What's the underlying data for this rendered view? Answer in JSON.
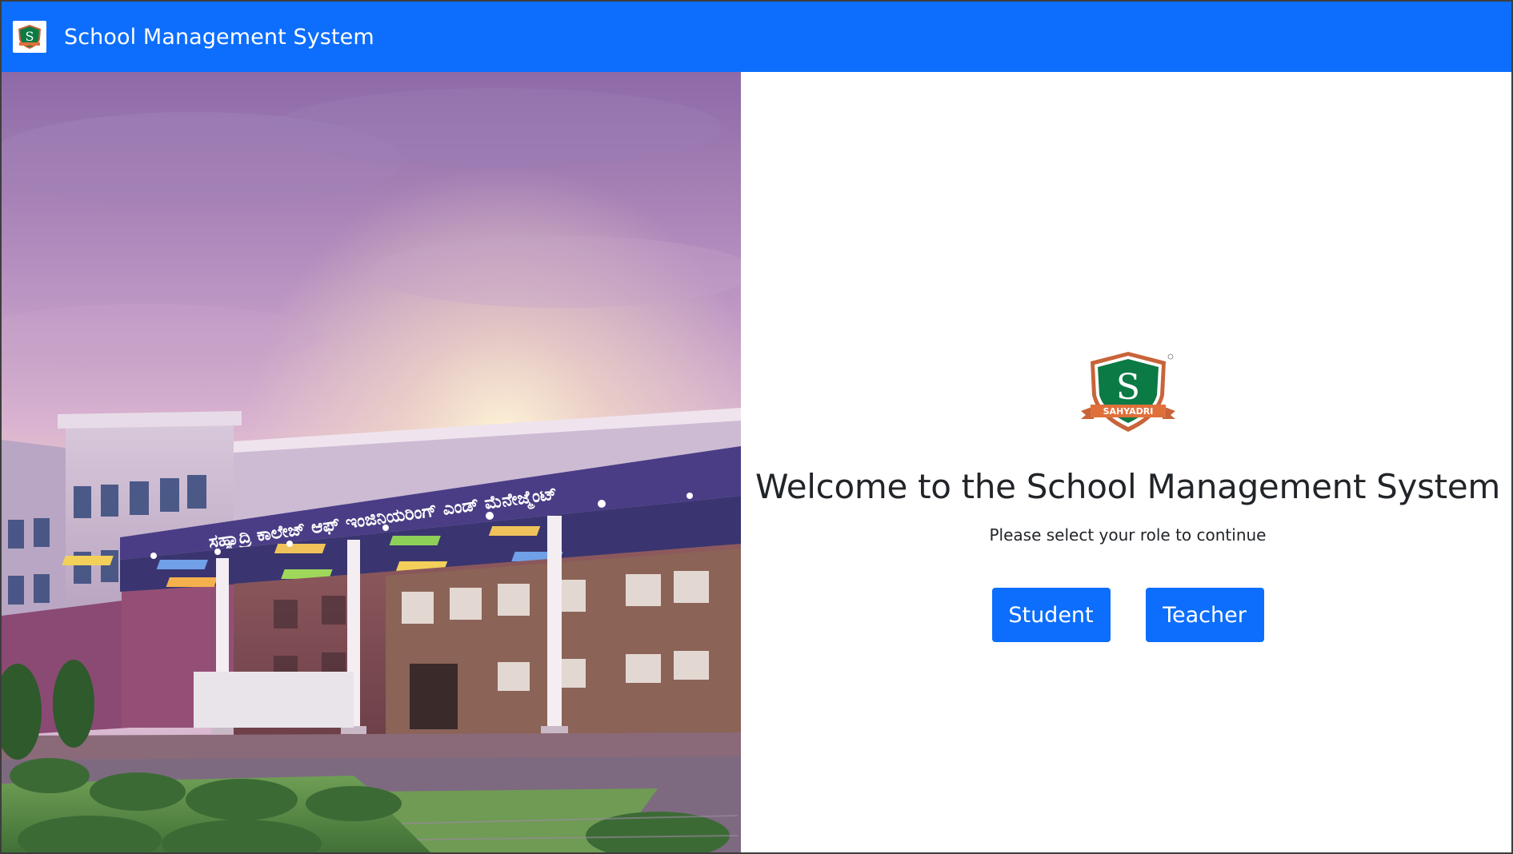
{
  "navbar": {
    "brand_title": "School Management System",
    "logo_letter": "S",
    "brand_color": "#0d6efd"
  },
  "hero": {
    "image_content": "campus-building-photo",
    "building_sign_text": "ಸಹ್ಯಾದ್ರಿ ಕಾಲೇಜ್ ಆಫ್ ಇಂಜಿನಿಯರಿಂಗ್ ಎಂಡ್ ಮೆನೇಜ್ಮೆಂಟ್"
  },
  "welcome": {
    "crest_letter": "S",
    "crest_ribbon_text": "SAHYADRI",
    "title": "Welcome to the School Management System",
    "subtitle": "Please select your role to continue",
    "buttons": [
      {
        "label": "Student"
      },
      {
        "label": "Teacher"
      }
    ]
  },
  "colors": {
    "primary": "#0d6efd",
    "text": "#212529",
    "crest_green": "#0b7a45",
    "crest_orange": "#e0703a"
  }
}
